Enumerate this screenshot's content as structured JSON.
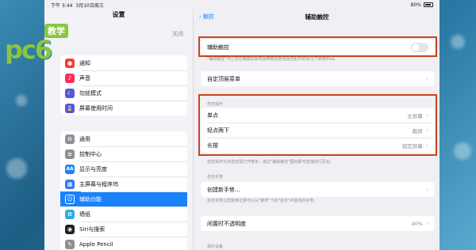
{
  "status": {
    "time": "下午 3:44",
    "date": "3月10日周三",
    "battery": "80%"
  },
  "sidebar": {
    "title": "设置",
    "bluetooth_value": "关闭",
    "group1": [
      {
        "label": "通知",
        "icon": "bell-icon",
        "color": "#ff3b30"
      },
      {
        "label": "声音",
        "icon": "speaker-icon",
        "color": "#ff2d55"
      },
      {
        "label": "勿扰模式",
        "icon": "moon-icon",
        "color": "#5856d6"
      },
      {
        "label": "屏幕使用时间",
        "icon": "hourglass-icon",
        "color": "#5856d6"
      }
    ],
    "group2": [
      {
        "label": "通用",
        "icon": "gear-icon",
        "color": "#8e8e93"
      },
      {
        "label": "控制中心",
        "icon": "switches-icon",
        "color": "#8e8e93"
      },
      {
        "label": "显示与亮度",
        "icon": "text-size-icon",
        "color": "#1a82fb"
      },
      {
        "label": "主屏幕与程序坞",
        "icon": "grid-icon",
        "color": "#3478f6"
      },
      {
        "label": "辅助功能",
        "icon": "accessibility-icon",
        "color": "#1a82fb",
        "selected": true
      },
      {
        "label": "墙纸",
        "icon": "flower-icon",
        "color": "#34aadc"
      },
      {
        "label": "Siri与搜索",
        "icon": "siri-icon",
        "color": "#222222"
      },
      {
        "label": "Apple Pencil",
        "icon": "pencil-icon",
        "color": "#8e8e93"
      }
    ]
  },
  "detail": {
    "back_label": "触控",
    "title": "辅助触控",
    "assistive_touch": {
      "label": "辅助触控",
      "on": false
    },
    "assistive_note": "\"辅助触控\"可让您在触摸屏幕有困难或需要自适应配件的情况下使用iPad。",
    "top_menu_label": "自定顶层菜单",
    "custom_actions_header": "自定操作",
    "actions": [
      {
        "label": "单点",
        "value": "主屏幕"
      },
      {
        "label": "轻点两下",
        "value": "截屏"
      },
      {
        "label": "长按",
        "value": "锁定屏幕"
      }
    ],
    "actions_note": "自定操作允许您无需打开菜单，通过\"辅助触控\"图标即可直接进行互动。",
    "custom_gestures_header": "自定手势",
    "new_gesture_label": "创建新手势...",
    "gesture_note": "自定手势让您能够记录可以从\"菜单\"下的\"自定\"中激活的手势。",
    "idle_opacity": {
      "label": "闲置时不透明度",
      "value": "40%"
    },
    "pointer_header": "指针设备"
  },
  "watermark": {
    "brand": "pc6",
    "tag": "教学"
  },
  "colors": {
    "accent": "#1a82fb",
    "highlight": "#c9441a",
    "brand": "#8bc53f"
  }
}
